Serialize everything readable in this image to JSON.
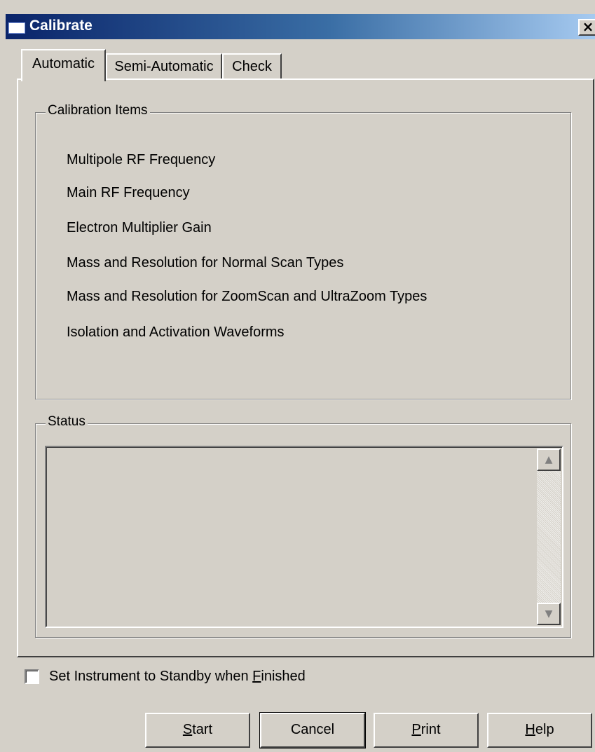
{
  "window": {
    "title": "Calibrate",
    "close_label": "×"
  },
  "tabs": [
    {
      "label": "Automatic",
      "active": true
    },
    {
      "label": "Semi-Automatic",
      "active": false
    },
    {
      "label": "Check",
      "active": false
    }
  ],
  "calibration_items": {
    "label": "Calibration Items",
    "items": [
      "Multipole RF Frequency",
      "Main RF Frequency",
      "Electron Multiplier Gain",
      "Mass and Resolution for Normal Scan Types",
      "Mass and Resolution for ZoomScan and UltraZoom Types",
      "Isolation and Activation Waveforms"
    ]
  },
  "status": {
    "label": "Status",
    "text": "",
    "scroll_up_glyph": "▲",
    "scroll_down_glyph": "▼"
  },
  "standby_option": {
    "label_pre": "Set Instrument to Standby when ",
    "label_mnemonic": "F",
    "label_post": "inished",
    "checked": false
  },
  "buttons": {
    "start": {
      "mnemonic": "S",
      "rest": "tart"
    },
    "cancel": {
      "label": "Cancel"
    },
    "print": {
      "mnemonic": "P",
      "rest": "rint"
    },
    "help": {
      "mnemonic": "H",
      "rest": "elp"
    }
  }
}
